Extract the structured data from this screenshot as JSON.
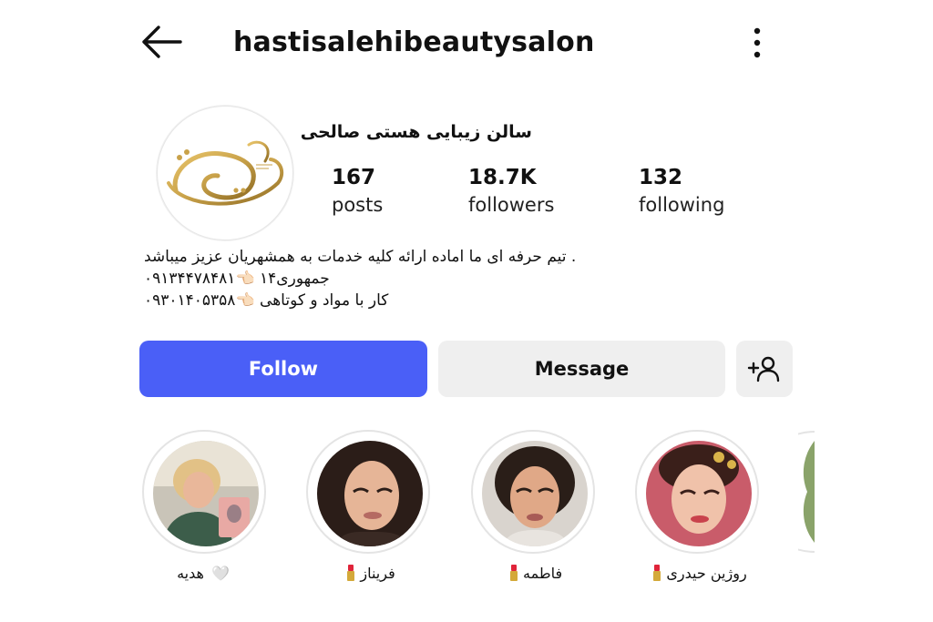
{
  "header": {
    "username": "hastisalehibeautysalon",
    "back_icon": "arrow-left-icon",
    "more_icon": "more-vertical-icon"
  },
  "profile": {
    "display_name": "سالن زیبایی هستی صالحی",
    "logo_icon": "salon-logo",
    "stats": [
      {
        "value": "167",
        "label": "posts"
      },
      {
        "value": "18.7K",
        "label": "followers"
      },
      {
        "value": "132",
        "label": "following"
      }
    ],
    "bio": [
      ". تیم حرفه ای ما اماده ارائه کلیه خدمات به همشهریان عزیز میباشد",
      "جمهوری۱۴ 👈🏻۰۹۱۳۴۴۷۸۴۸۱",
      "کار با مواد و کوتاهی 👈🏻۰۹۳۰۱۴۰۵۳۵۸"
    ]
  },
  "actions": {
    "follow_label": "Follow",
    "message_label": "Message",
    "add_user_icon": "add-user-icon"
  },
  "highlights": [
    {
      "label": "هدیه",
      "emoji": "🤍"
    },
    {
      "label": "فریناز",
      "emoji": "💄"
    },
    {
      "label": "فاطمه",
      "emoji": "💄"
    },
    {
      "label": "روژین حیدری",
      "emoji": "💄"
    }
  ],
  "colors": {
    "follow_button": "#4a5ff7",
    "secondary_button": "#efefef",
    "logo_gold": "#c9a24a"
  }
}
